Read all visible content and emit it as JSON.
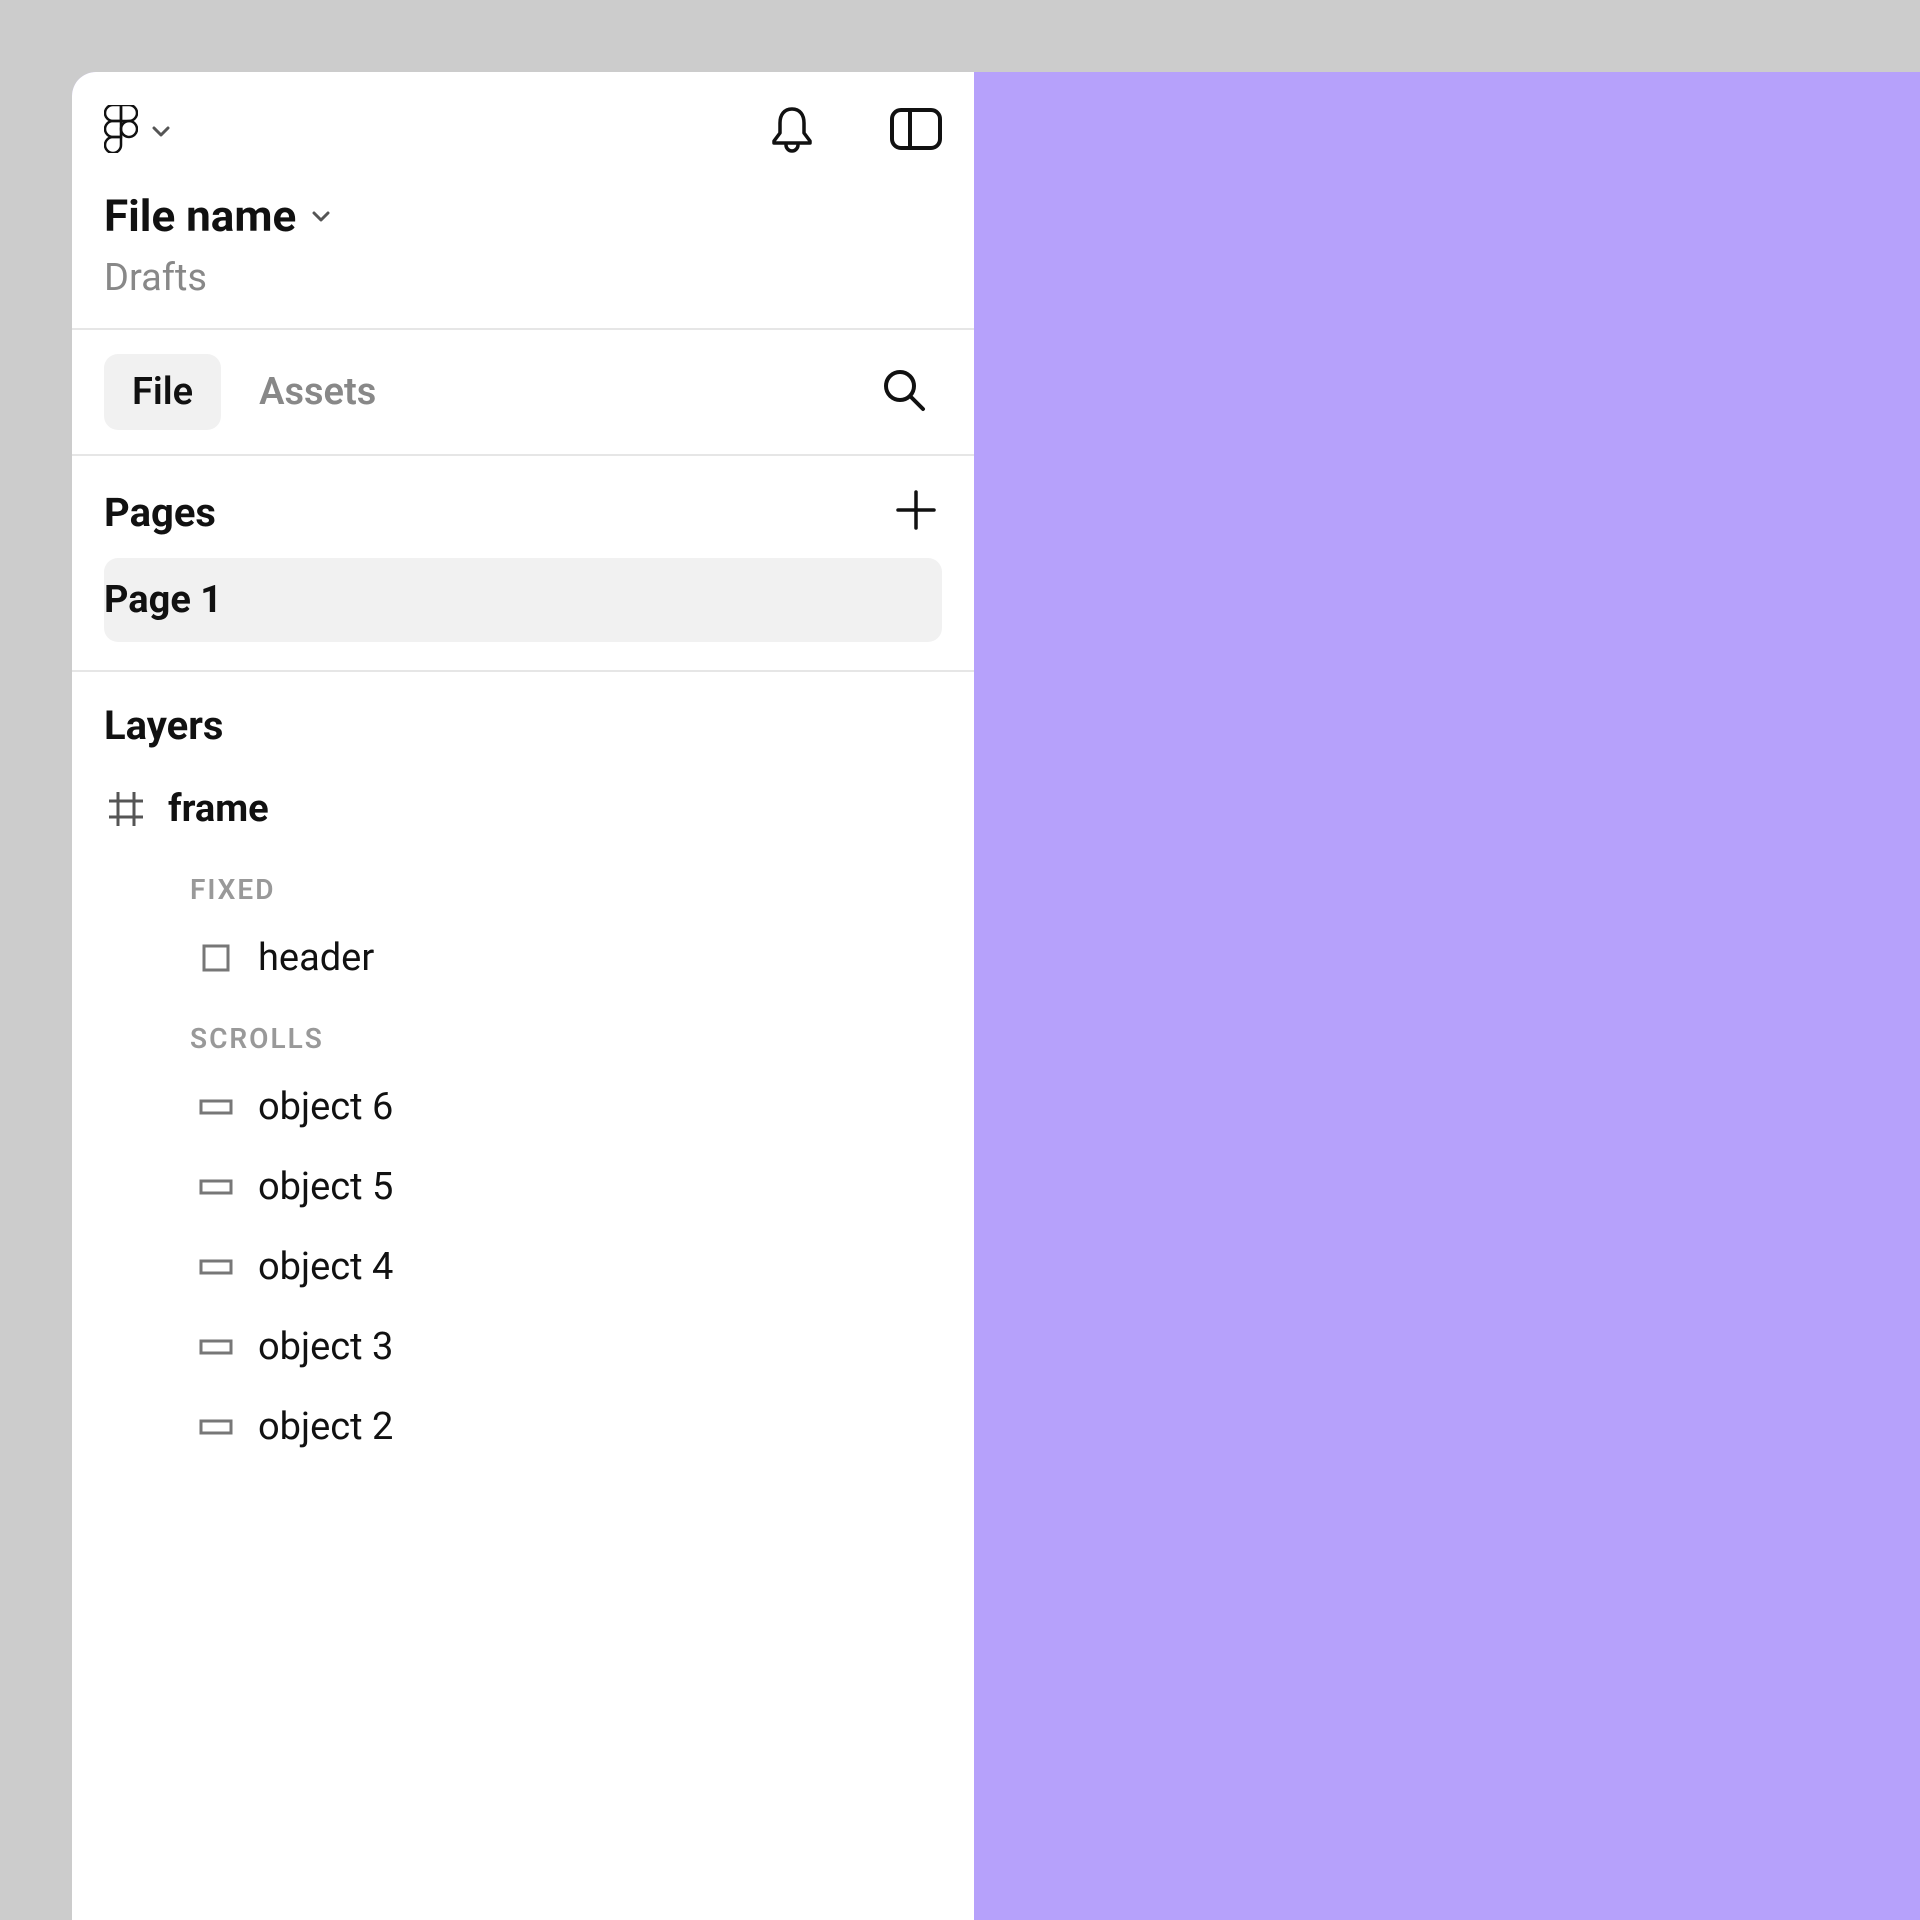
{
  "header": {
    "file_title": "File name",
    "file_subtitle": "Drafts"
  },
  "tabs": {
    "file": "File",
    "assets": "Assets"
  },
  "pages": {
    "title": "Pages",
    "items": [
      "Page 1"
    ]
  },
  "layers": {
    "title": "Layers",
    "root": {
      "name": "frame"
    },
    "groups": [
      {
        "label": "FIXED",
        "items": [
          {
            "name": "header",
            "icon": "square"
          }
        ]
      },
      {
        "label": "SCROLLS",
        "items": [
          {
            "name": "object 6",
            "icon": "rect"
          },
          {
            "name": "object 5",
            "icon": "rect"
          },
          {
            "name": "object 4",
            "icon": "rect"
          },
          {
            "name": "object 3",
            "icon": "rect"
          },
          {
            "name": "object 2",
            "icon": "rect"
          }
        ]
      }
    ]
  },
  "colors": {
    "canvas": "#b6a1fb",
    "page_bg": "#cccccc"
  }
}
